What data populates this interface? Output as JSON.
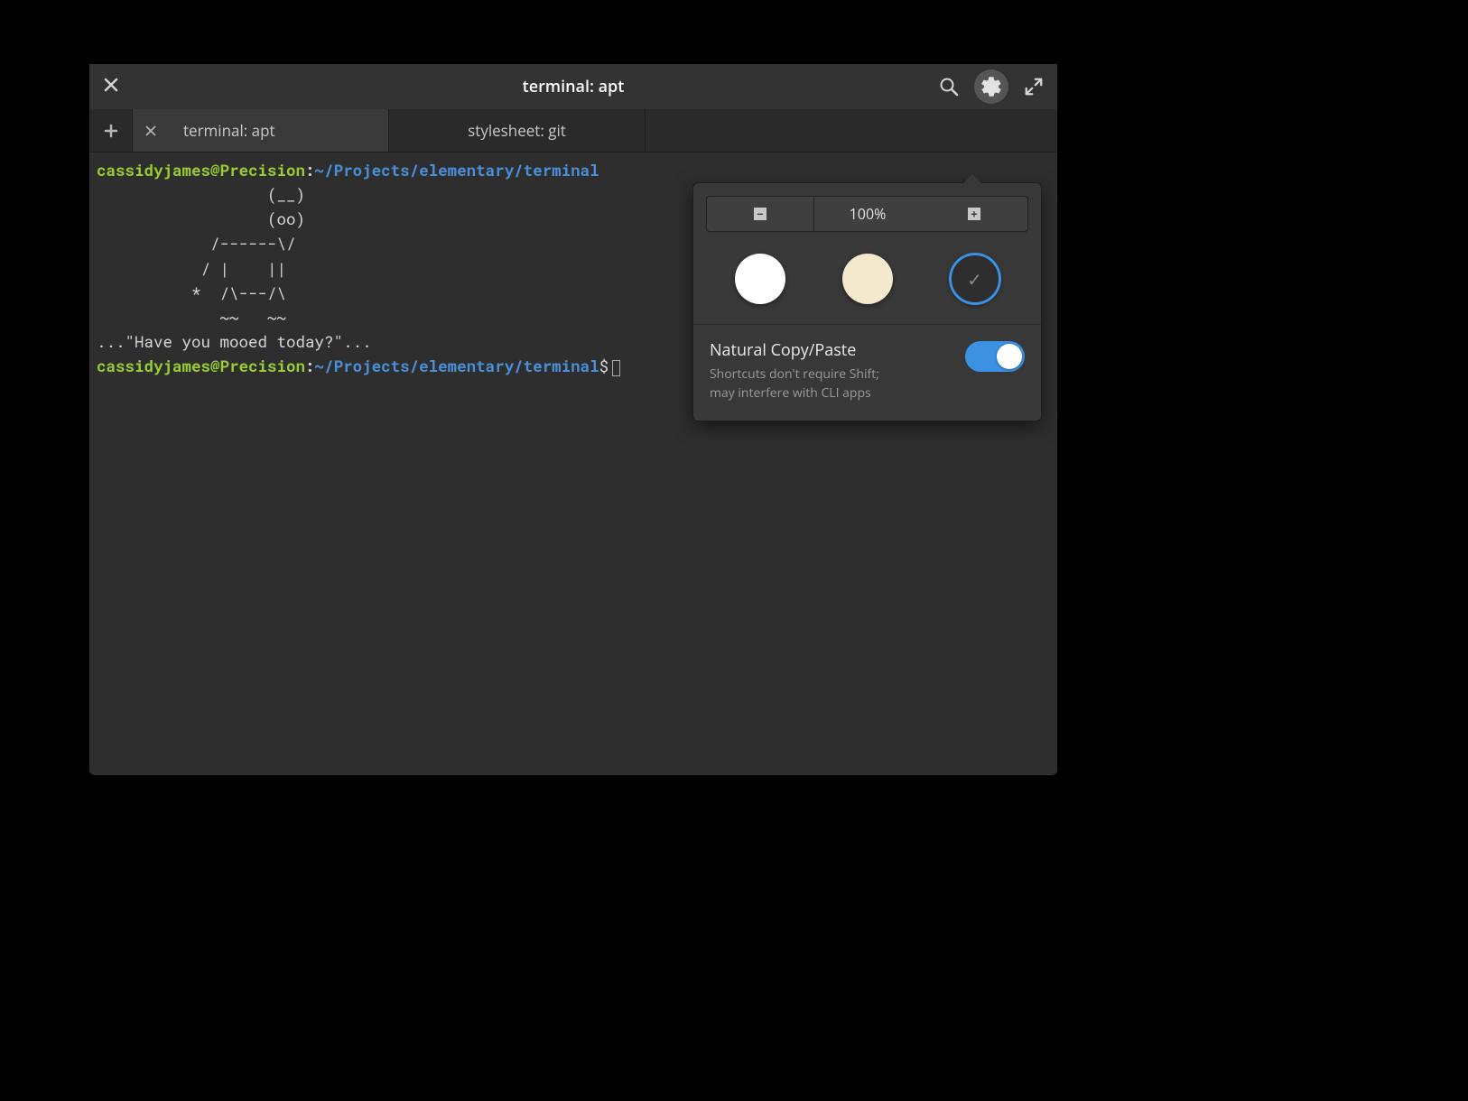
{
  "header": {
    "title": "terminal: apt"
  },
  "tabs": [
    {
      "label": "terminal: apt"
    },
    {
      "label": "stylesheet: git"
    }
  ],
  "terminal": {
    "user_host": "cassidyjames@Precision",
    "path": "~/Projects/elementary/terminal",
    "art_line1": "                  (__)",
    "art_line2": "                  (oo)",
    "art_line3": "            /------\\/",
    "art_line4": "           / |    ||",
    "art_line5": "          *  /\\---/\\",
    "art_line6": "             ~~   ~~",
    "quote": "...\"Have you mooed today?\"..."
  },
  "popover": {
    "zoom": "100%",
    "setting_title": "Natural Copy/Paste",
    "setting_desc1": "Shortcuts don't require Shift;",
    "setting_desc2": "may interfere with CLI apps"
  }
}
